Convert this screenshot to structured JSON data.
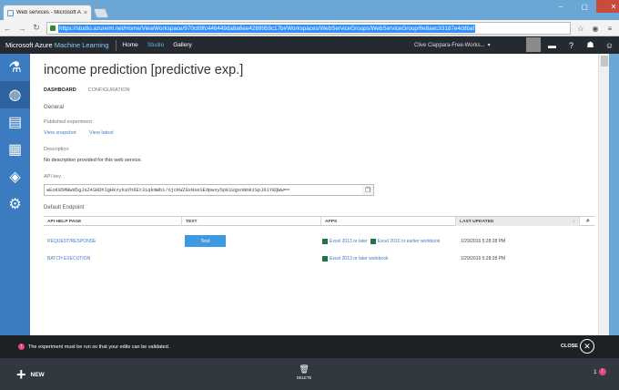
{
  "browser": {
    "tab_title": "Web services - Microsoft A",
    "tab_close": "×",
    "url": "https://studio.azureml.net/Home/ViewWorkspace/970c89fc446449da8a6ee4289959c17b#Workspaces/WebServiceGroups/WebServiceGroup/6e8aec33187e4c8baf"
  },
  "header": {
    "brand_main": "Microsoft Azure",
    "brand_sub": "Machine Learning",
    "nav": [
      {
        "label": "Home"
      },
      {
        "label": "Studio"
      },
      {
        "label": "Gallery"
      }
    ],
    "user": "Clive Ciappara-Free-Works...",
    "user_caret": "▾"
  },
  "page": {
    "title": "income prediction [predictive exp.]",
    "tabs": [
      {
        "label": "DASHBOARD"
      },
      {
        "label": "CONFIGURATION"
      }
    ],
    "general_heading": "General",
    "published_label": "Published experiment",
    "view_snapshot": "View snapshot",
    "view_latest": "View latest",
    "description_label": "Description",
    "description_text": "No description provided for this web service.",
    "api_key_label": "API key",
    "api_key": "wEoK05MBWd5gJsZ4SHDhIgHkxykaYh6Et31qkmWb1/ojcKWZGxNseSEdpwxy5pKiUgsoNmkzSpJ61Y8QWw==",
    "endpoint_heading": "Default Endpoint"
  },
  "table": {
    "headers": [
      "API HELP PAGE",
      "TEST",
      "APPS",
      "LAST UPDATED"
    ],
    "sort_icon": "↓",
    "search_icon": "⌕",
    "rows": [
      {
        "help": "REQUEST/RESPONSE",
        "test": "Test",
        "app1": "Excel 2013 or later",
        "app2": "Excel 2010 or earlier workbook",
        "updated": "1/29/2016 5:28:28 PM"
      },
      {
        "help": "BATCH EXECUTION",
        "app1": "Excel 2013 or later workbook",
        "updated": "1/29/2016 5:28:28 PM"
      }
    ]
  },
  "notification": {
    "message": "The experiment must be run so that your edits can be validated.",
    "close_label": "CLOSE"
  },
  "commands": {
    "new_label": "NEW",
    "delete_label": "DELETE",
    "badge_count": "1"
  },
  "colors": {
    "header_bg": "#252a30",
    "nav_bg": "#3b7bbf",
    "accent": "#3d9ae0",
    "alert": "#e04880"
  }
}
